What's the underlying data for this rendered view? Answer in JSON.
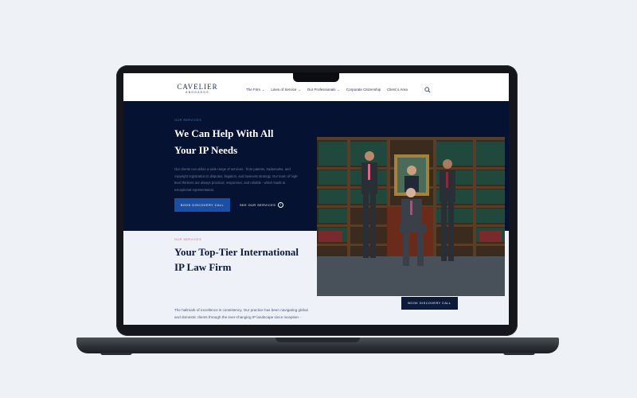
{
  "brand": {
    "name": "CAVELIER",
    "tagline": "ABOGADOS"
  },
  "nav": {
    "items": [
      {
        "label": "The Firm",
        "dropdown": true
      },
      {
        "label": "Lines of Service",
        "dropdown": true
      },
      {
        "label": "Our Professionals",
        "dropdown": true
      },
      {
        "label": "Corporate Citizenship",
        "dropdown": false
      },
      {
        "label": "Client´s Area",
        "dropdown": false
      }
    ]
  },
  "hero": {
    "eyebrow": "Our Services",
    "title_line1": "We Can Help With All",
    "title_line2": "Your IP Needs",
    "body": "Our clients can utilize a wide range of services - from patents, trademarks, and copyright registration to disputes, litigation, and business strategy. Our team of high-level thinkers are always practical, responsive, and reliable - which leads to exceptional representation.",
    "cta_primary": "Book Discovery Call",
    "cta_secondary": "See Our Services"
  },
  "section2": {
    "eyebrow": "Our Services",
    "title_line1": "Your Top-Tier International",
    "title_line2": "IP Law Firm",
    "body_line1": "The hallmark of excellence is consistency. Our practice has been navigating global",
    "body_line2": "and domestic clients through the ever-changing IP landscape since inception -",
    "cta": "Book Discovery Call"
  },
  "colors": {
    "navy": "#051232",
    "accent_blue": "#1a4fa5",
    "eyebrow_blue": "#4f7de0",
    "eyebrow_red": "#d95a5a",
    "light_bg": "#eef2f8"
  }
}
